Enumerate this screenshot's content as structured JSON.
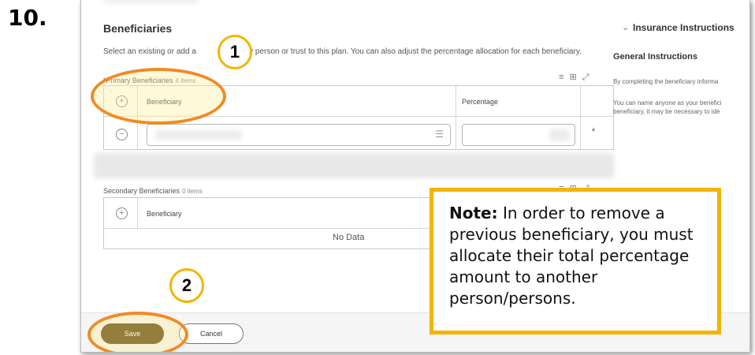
{
  "step_number": "10.",
  "form": {
    "section_title": "Beneficiaries",
    "intro_text": "Select an existing or add a new beneficiary person or trust to this plan. You can also adjust the percentage allocation for each beneficiary.",
    "primary": {
      "required_marker": "*",
      "label": "Primary Beneficiaries",
      "count": "4 items",
      "col_beneficiary": "Beneficiary",
      "col_percentage": "Percentage"
    },
    "secondary": {
      "label": "Secondary Beneficiaries",
      "count": "0 items",
      "col_beneficiary": "Beneficiary",
      "empty_text": "No Data"
    },
    "toolbar_glyphs": "≡ ⊞ ⤢",
    "save_label": "Save",
    "cancel_label": "Cancel"
  },
  "side_panel": {
    "title": "Insurance Instructions",
    "subtitle": "General Instructions",
    "line1": "By completing the beneficiary informa",
    "line2": "You can name anyone as your benefici",
    "line3": "beneficiary, it may be necessary to ide"
  },
  "callouts": {
    "badge1": "1",
    "badge2": "2"
  },
  "note": {
    "prefix": "Note:",
    "text": " In order to remove a previous beneficiary, you must allocate their total percentage amount to another person/persons."
  },
  "icons": {
    "add": "+",
    "remove": "−",
    "chevron": "⌄",
    "list": "☰",
    "up": "▲"
  }
}
